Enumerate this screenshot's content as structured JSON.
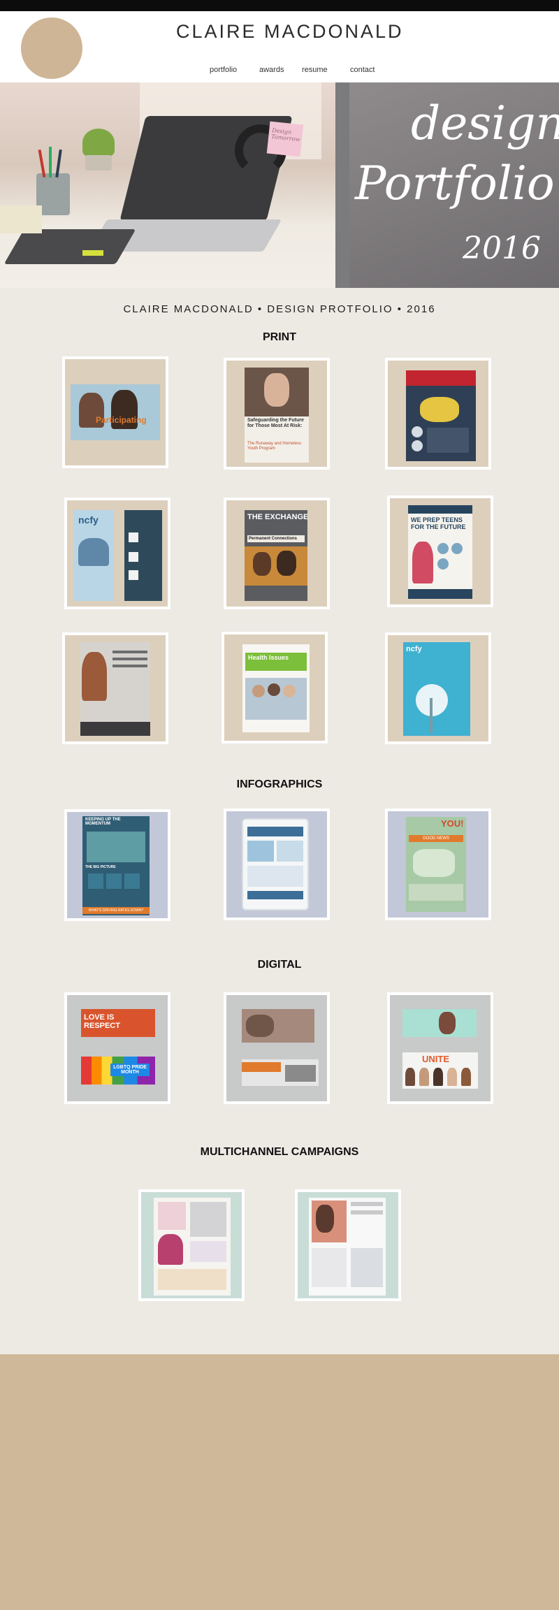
{
  "header": {
    "title": "CLAIRE MACDONALD",
    "nav": [
      "portfolio",
      "awards",
      "resume",
      "contact"
    ]
  },
  "hero": {
    "line1": "design",
    "line2": "Portfolio",
    "year": "2016",
    "sticky_note": "Design Tomorrow"
  },
  "subtitle": "CLAIRE MACDONALD • DESIGN PROTFOLIO • 2016",
  "sections": {
    "print": "PRINT",
    "infographics": "INFOGRAPHICS",
    "digital": "DIGITAL",
    "multichannel": "MULTICHANNEL CAMPAIGNS"
  },
  "thumbs": {
    "print1": "Participating",
    "print2a": "Safeguarding the Future for Those Most At Risk:",
    "print2b": "The Runaway and Homeless Youth Program",
    "print4": "ncfy",
    "print5a": "THE EXCHANGE",
    "print5b": "Permanent Connections",
    "print6": "WE PREP TEENS FOR THE FUTURE",
    "print8": "Health Issues",
    "print9": "ncfy",
    "info1a": "KEEPING UP THE MOMENTUM",
    "info1b": "THE BIG PICTURE",
    "info1c": "WHAT'S DRIVING RATES DOWN?",
    "info3a": "YOU!",
    "info3b": "GOOD NEWS",
    "dig1a": "LOVE IS RESPECT",
    "dig1b": "LGBTQ PRIDE MONTH",
    "dig3": "UNITE"
  },
  "colors": {
    "topbar": "#0c0c0c",
    "logo": "#cdb596",
    "page_bg": "#ede9e3",
    "footer": "#cfb899",
    "print_mat": "#dccfbc",
    "info_mat": "#c3c8d8",
    "digital_mat": "#c8c9c9",
    "multi_mat": "#c9ddd7"
  }
}
